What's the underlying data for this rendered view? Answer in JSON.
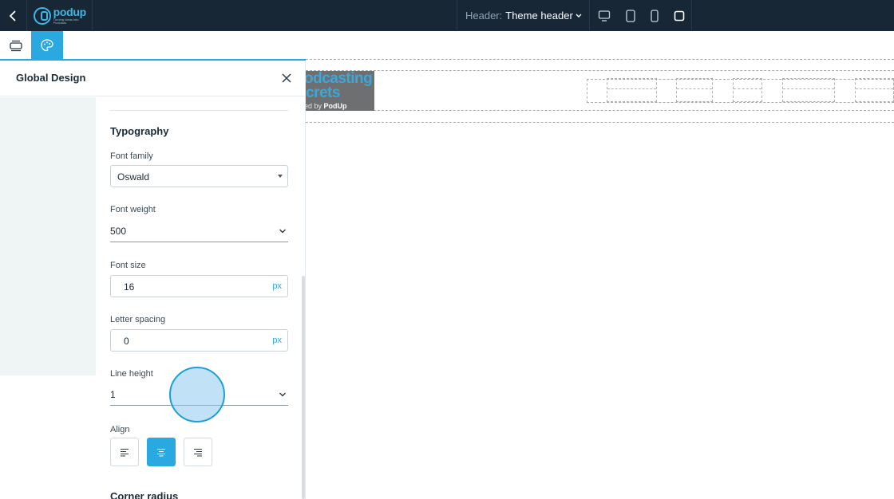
{
  "topbar": {
    "logo_word": "podup",
    "logo_tagline": "Turning Ideas into Podcasts",
    "header_label": "Header:",
    "header_value": "Theme header"
  },
  "panel": {
    "title": "Global Design",
    "section_title": "Typography",
    "next_section_title": "Corner radius",
    "font_family": {
      "label": "Font family",
      "value": "Oswald"
    },
    "font_weight": {
      "label": "Font weight",
      "value": "500"
    },
    "font_size": {
      "label": "Font size",
      "value": "16",
      "unit": "px"
    },
    "letter_spacing": {
      "label": "Letter spacing",
      "value": "0",
      "unit": "px"
    },
    "line_height": {
      "label": "Line height",
      "value": "1"
    },
    "align": {
      "label": "Align",
      "options": [
        "left",
        "center",
        "right"
      ],
      "selected": "center"
    }
  },
  "canvas": {
    "logo_line1": "odcasting",
    "logo_line2": "crets",
    "logo_line3_prefix": "ed by ",
    "logo_line3_brand": "PodUp"
  },
  "colors": {
    "topbar_bg": "#172735",
    "accent": "#2aa9e0",
    "panel_side_bg": "#eff4f5"
  }
}
